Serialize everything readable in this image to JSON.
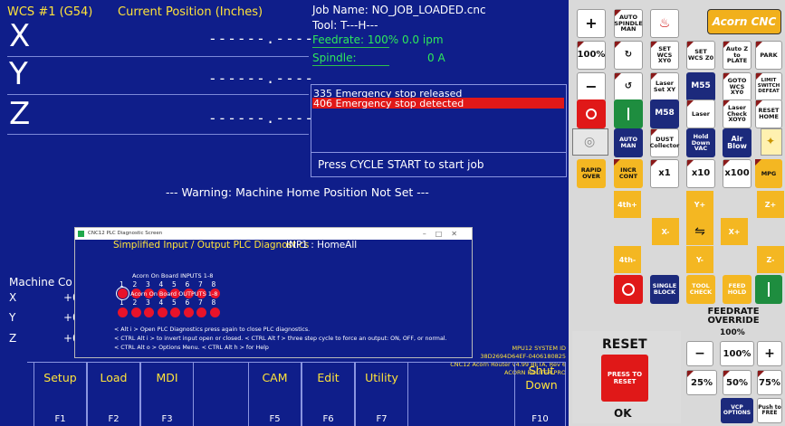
{
  "dro": {
    "wcs": "WCS #1 (G54)",
    "current_position": "Current Position (Inches)",
    "axes": [
      {
        "name": "X",
        "value": "------.----"
      },
      {
        "name": "Y",
        "value": "------.----"
      },
      {
        "name": "Z",
        "value": "------.----"
      }
    ]
  },
  "job": {
    "name": "Job Name: NO_JOB_LOADED.cnc",
    "tool": "Tool:      T---H---",
    "feedrate": "Feedrate: 100%  0.0 ipm",
    "spindle_label": "Spindle:",
    "spindle_value": "0  A"
  },
  "messages": [
    "335 Emergency stop released",
    "406 Emergency stop detected"
  ],
  "cycle_start": "Press CYCLE START to start job",
  "warning": "--- Warning: Machine Home Position Not Set ---",
  "machine_coords": {
    "label": "Machine Co",
    "rows": [
      {
        "axis": "X",
        "value": "+0"
      },
      {
        "axis": "Y",
        "value": "+0"
      },
      {
        "axis": "Z",
        "value": "+0"
      }
    ]
  },
  "plc_dialog": {
    "window_title": "CNC12 PLC Diagnostic Screen",
    "heading": "Simplified Input / Output PLC Diagnostics",
    "inp_status": "INP1 : HomeAll",
    "inputs_label": "Acorn On Board INPUTS 1-8",
    "outputs_label": "Acorn On Board OUTPUTS 1-8",
    "numbers": [
      "1",
      "2",
      "3",
      "4",
      "5",
      "6",
      "7",
      "8"
    ],
    "help": [
      "< Alt i > Open PLC Diagnostics press again to close PLC diagnostics.",
      "< CTRL Alt i > to invert input open or closed. < CTRL Alt f > three step cycle to force an output: ON, OFF, or normal.",
      "< CTRL Alt o > Options Menu. < CTRL Alt h > for Help"
    ]
  },
  "version": {
    "line1": "MPU12 SYSTEM ID",
    "line2": "38D2694D64EF-0406180825",
    "line3": "CNC12 Acorn Router v4.99 BETA, Rev 6",
    "line4": "ACORN ROUTER PRO"
  },
  "footer": [
    {
      "label": "Setup",
      "fn": "F1"
    },
    {
      "label": "Load",
      "fn": "F2"
    },
    {
      "label": "MDI",
      "fn": "F3"
    },
    {
      "label": "CAM",
      "fn": "F5"
    },
    {
      "label": "Edit",
      "fn": "F6"
    },
    {
      "label": "Utility",
      "fn": "F7"
    },
    {
      "label": "Shut Down",
      "fn": "F10"
    }
  ],
  "vcp": {
    "logo": "Acorn CNC",
    "auto_spindle_man": "AUTO SPINDLE MAN",
    "pct100": "100%",
    "set_wcs_xy0": "SET WCS XY0",
    "set_wcs_z0": "SET WCS Z0",
    "autoz_plate": "Auto Z to PLATE",
    "park": "PARK",
    "m55": "M55",
    "goto_wcs_xy0": "GOTO WCS XY0",
    "limit_switch_defeat": "LIMIT SWITCH DEFEAT",
    "laser_set_xy": "Laser Set XY",
    "m58": "M58",
    "laser": "Laser",
    "laser_check": "Laser Check XOY0",
    "reset_home": "RESET HOME",
    "auto_man": "AUTO MAN",
    "dust_collector": "DUST Collector",
    "hold_down_vac": "Hold Down VAC",
    "air_blow": "Air Blow",
    "rapid_over": "RAPID OVER",
    "incr_cont": "INCR CONT",
    "x1": "x1",
    "x10": "x10",
    "x100": "x100",
    "mpg": "MPG",
    "jog": {
      "4p": "4th+",
      "yp": "Y+",
      "zp": "Z+",
      "xm": "X-",
      "xp": "X+",
      "4m": "4th-",
      "ym": "Y-",
      "zm": "Z-"
    },
    "single_block": "SINGLE BLOCK",
    "tool_check": "TOOL CHECK",
    "feed_hold": "FEED HOLD",
    "feedrate_override": "FEEDRATE OVERRIDE",
    "override_value": "100%",
    "ov_minus": "−",
    "ov_100": "100%",
    "ov_plus": "+",
    "ov_25": "25%",
    "ov_50": "50%",
    "ov_75": "75%",
    "reset": "RESET",
    "press_to_reset": "PRESS TO RESET",
    "ok": "OK",
    "vcp_options": "VCP OPTIONS",
    "push_to_free": "Push to FREE"
  }
}
